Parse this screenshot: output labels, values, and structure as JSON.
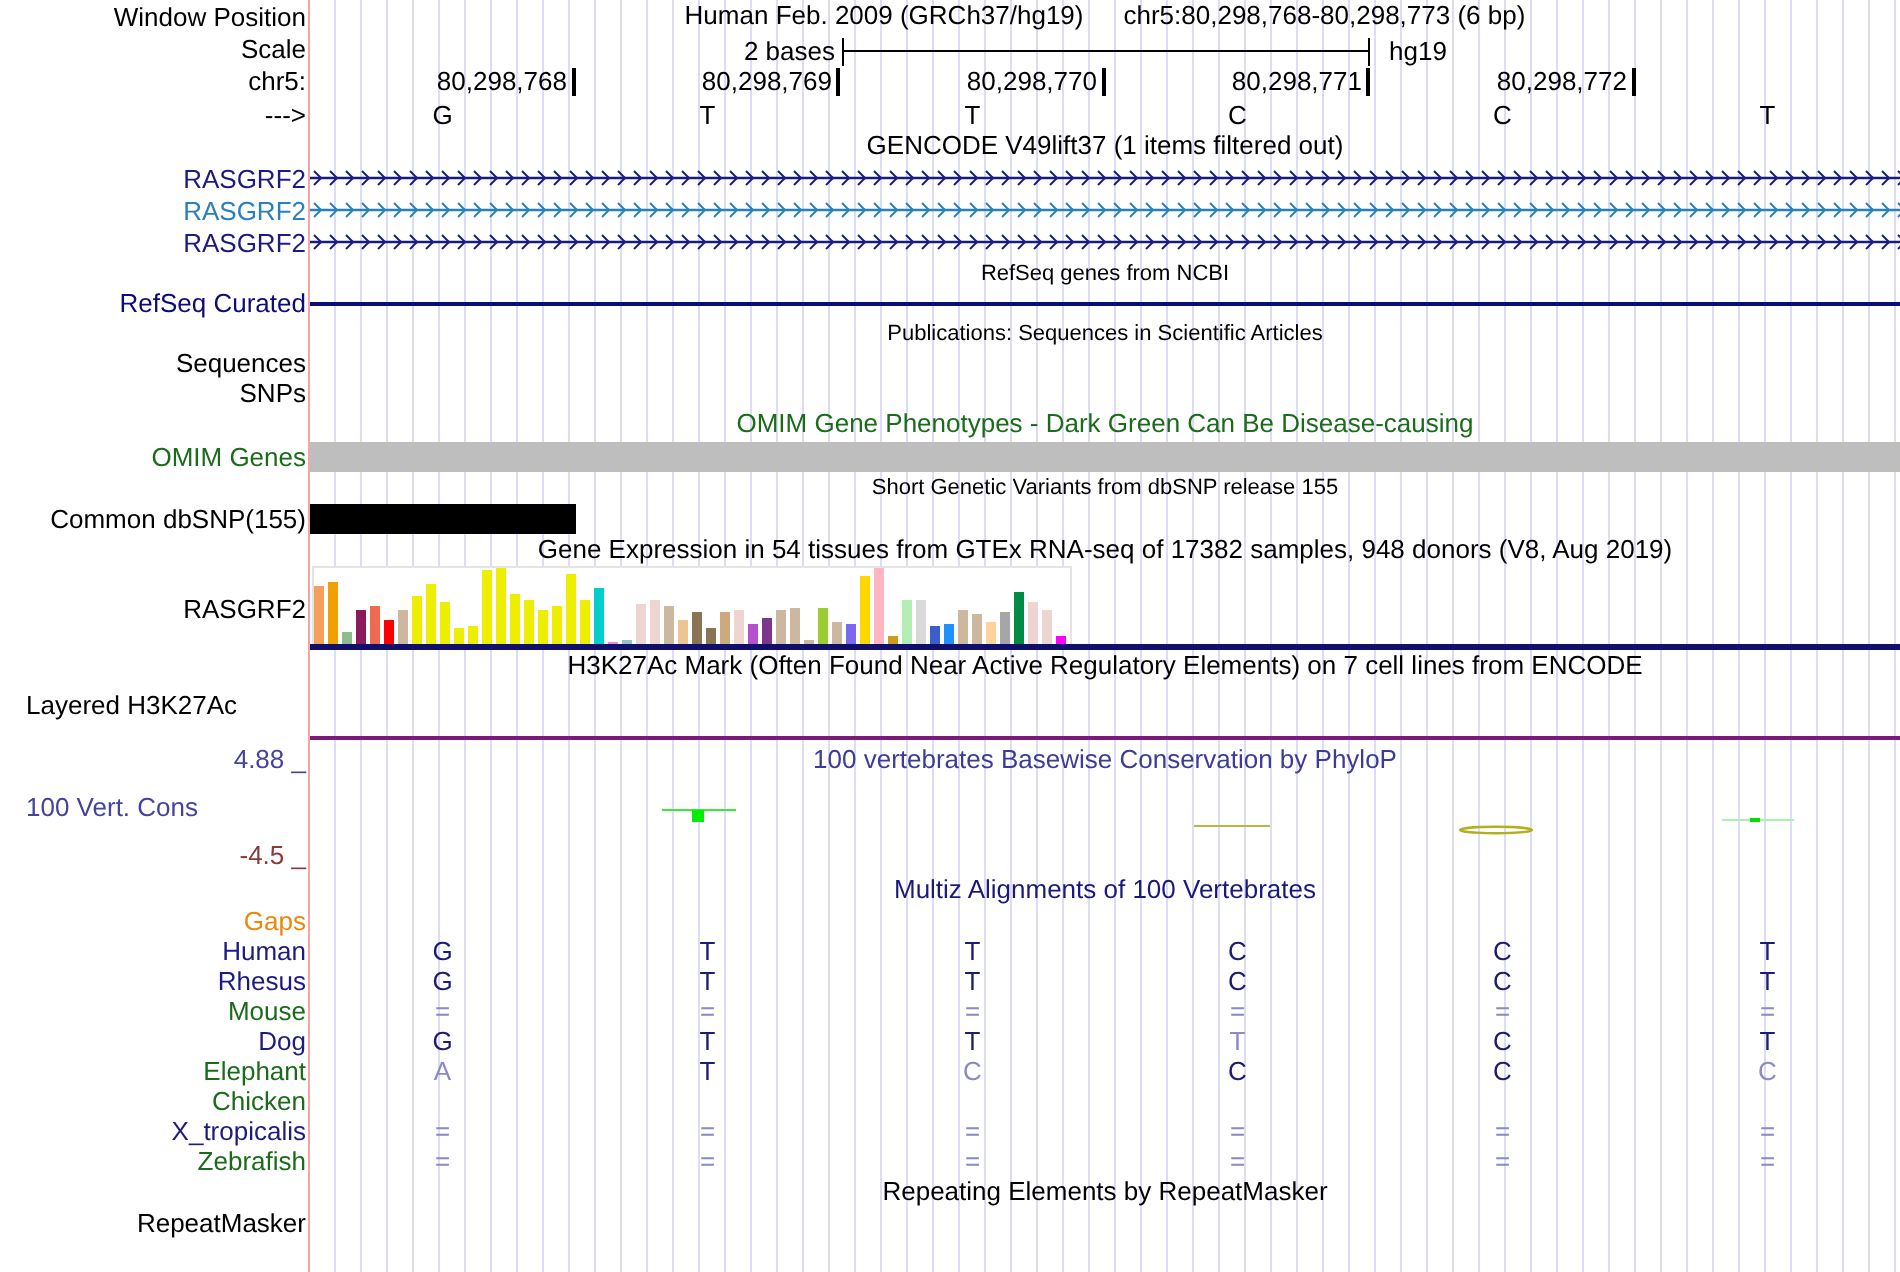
{
  "header": {
    "position_label": "Window Position",
    "genome": "Human Feb. 2009 (GRCh37/hg19)",
    "range": "chr5:80,298,768-80,298,773 (6 bp)",
    "scale_label": "Scale",
    "scale_text": "2 bases",
    "assembly": "hg19",
    "chrom_label": "chr5:",
    "ticks": [
      "80,298,768",
      "80,298,769",
      "80,298,770",
      "80,298,771",
      "80,298,772"
    ],
    "strand_label": "--->",
    "bases": [
      "G",
      "T",
      "T",
      "C",
      "C",
      "T"
    ]
  },
  "tracks": [
    {
      "kind": "genes",
      "title": "GENCODE V49lift37 (1 items filtered out)",
      "small": false,
      "color": "#000000",
      "items": [
        {
          "label": "RASGRF2",
          "color": "#1c1c80"
        },
        {
          "label": "RASGRF2",
          "color": "#2a7fbf"
        },
        {
          "label": "RASGRF2",
          "color": "#1c1c80"
        }
      ]
    },
    {
      "kind": "line",
      "title": "RefSeq genes from NCBI",
      "small": true,
      "color": "#000000",
      "items": [
        {
          "label": "RefSeq Curated",
          "color": "#0c0c78"
        }
      ]
    },
    {
      "kind": "labels",
      "title": "Publications: Sequences in Scientific Articles",
      "small": true,
      "color": "#000000",
      "items": [
        {
          "label": "Sequences",
          "color": "#000000"
        },
        {
          "label": "SNPs",
          "color": "#000000"
        }
      ]
    },
    {
      "kind": "bar",
      "title": "OMIM Gene Phenotypes - Dark Green Can Be Disease-causing",
      "small": false,
      "color": "#1a6b1a",
      "items": [
        {
          "label": "OMIM Genes",
          "color": "#bebebe",
          "level": 1
        }
      ]
    },
    {
      "kind": "bar",
      "title": "Short Genetic Variants from dbSNP release 155",
      "small": true,
      "color": "#000000",
      "items": [
        {
          "label": "Common dbSNP(155)",
          "color": "#000000",
          "level": 0.1667
        }
      ]
    },
    {
      "kind": "expression",
      "title": "Gene Expression in 54 tissues from GTEx RNA-seq of 17382 samples, 948 donors (V8, Aug 2019)",
      "small": false,
      "color": "#000000",
      "items": [
        {
          "label": "RASGRF2",
          "color": "#000000"
        }
      ]
    },
    {
      "kind": "signal",
      "title": "H3K27Ac Mark (Often Found Near Active Regulatory Elements) on 7 cell lines from ENCODE",
      "small": false,
      "color": "#000000",
      "items": [
        {
          "label": "Layered H3K27Ac",
          "color": "#000000"
        }
      ]
    },
    {
      "kind": "wiggle",
      "title": "100 vertebrates Basewise Conservation by PhyloP",
      "small": false,
      "color": "#3c3c96",
      "items": [
        {
          "label": "4.88 _",
          "color": "#44449a"
        },
        {
          "label": "100 Vert. Cons",
          "color": "#44449a"
        },
        {
          "label": "-4.5 _",
          "color": "#8b3a3a"
        }
      ]
    },
    {
      "kind": "alignment",
      "title": "Multiz Alignments of 100 Vertebrates",
      "small": false,
      "color": "#1a1a7a",
      "items": [
        {
          "label": "Gaps",
          "color": "#e8890c"
        },
        {
          "label": "Human",
          "color": "#1c1c80",
          "cells": [
            {
              "base": "G",
              "faint": false
            },
            {
              "base": "T",
              "faint": false
            },
            {
              "base": "T",
              "faint": false
            },
            {
              "base": "C",
              "faint": false
            },
            {
              "base": "C",
              "faint": false
            },
            {
              "base": "T",
              "faint": false
            }
          ]
        },
        {
          "label": "Rhesus",
          "color": "#1c1c80",
          "cells": [
            {
              "base": "G",
              "faint": false
            },
            {
              "base": "T",
              "faint": false
            },
            {
              "base": "T",
              "faint": false
            },
            {
              "base": "C",
              "faint": false
            },
            {
              "base": "C",
              "faint": false
            },
            {
              "base": "T",
              "faint": false
            }
          ]
        },
        {
          "label": "Mouse",
          "color": "#1a6b1a",
          "cells": [
            {
              "base": "=",
              "faint": true
            },
            {
              "base": "=",
              "faint": true
            },
            {
              "base": "=",
              "faint": true
            },
            {
              "base": "=",
              "faint": true
            },
            {
              "base": "=",
              "faint": true
            },
            {
              "base": "=",
              "faint": true
            }
          ]
        },
        {
          "label": "Dog",
          "color": "#1c1c80",
          "cells": [
            {
              "base": "G",
              "faint": false
            },
            {
              "base": "T",
              "faint": false
            },
            {
              "base": "T",
              "faint": false
            },
            {
              "base": "T",
              "faint": true
            },
            {
              "base": "C",
              "faint": false
            },
            {
              "base": "T",
              "faint": false
            }
          ]
        },
        {
          "label": "Elephant",
          "color": "#1a6b1a",
          "cells": [
            {
              "base": "A",
              "faint": true
            },
            {
              "base": "T",
              "faint": false
            },
            {
              "base": "C",
              "faint": true
            },
            {
              "base": "C",
              "faint": false
            },
            {
              "base": "C",
              "faint": false
            },
            {
              "base": "C",
              "faint": true
            }
          ]
        },
        {
          "label": "Chicken",
          "color": "#1a6b1a"
        },
        {
          "label": "X_tropicalis",
          "color": "#1c1c80",
          "cells": [
            {
              "base": "=",
              "faint": true
            },
            {
              "base": "=",
              "faint": true
            },
            {
              "base": "=",
              "faint": true
            },
            {
              "base": "=",
              "faint": true
            },
            {
              "base": "=",
              "faint": true
            },
            {
              "base": "=",
              "faint": true
            }
          ]
        },
        {
          "label": "Zebrafish",
          "color": "#1a6b1a",
          "cells": [
            {
              "base": "=",
              "faint": true
            },
            {
              "base": "=",
              "faint": true
            },
            {
              "base": "=",
              "faint": true
            },
            {
              "base": "=",
              "faint": true
            },
            {
              "base": "=",
              "faint": true
            },
            {
              "base": "=",
              "faint": true
            }
          ]
        }
      ]
    },
    {
      "kind": "plain",
      "title": "Repeating Elements by RepeatMasker",
      "small": false,
      "color": "#000000",
      "items": [
        {
          "label": "RepeatMasker",
          "color": "#000000"
        }
      ]
    }
  ]
}
